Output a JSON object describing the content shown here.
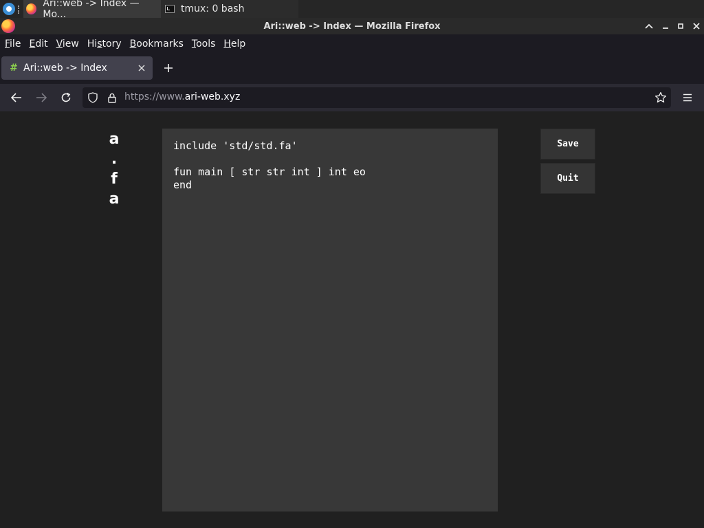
{
  "taskbar": {
    "tasks": [
      {
        "label": "Ari::web -> Index — Mo...",
        "icon": "firefox-icon"
      },
      {
        "label": "tmux: 0 bash",
        "icon": "terminal-icon"
      }
    ]
  },
  "window": {
    "title": "Ari::web -> Index — Mozilla Firefox"
  },
  "menu": {
    "items": [
      {
        "label": "File",
        "u": "F",
        "rest": "ile"
      },
      {
        "label": "Edit",
        "u": "E",
        "rest": "dit"
      },
      {
        "label": "View",
        "u": "V",
        "rest": "iew"
      },
      {
        "label": "History",
        "u": "",
        "pre": "Hi",
        "uu": "s",
        "rest": "tory"
      },
      {
        "label": "Bookmarks",
        "u": "B",
        "rest": "ookmarks"
      },
      {
        "label": "Tools",
        "u": "T",
        "rest": "ools"
      },
      {
        "label": "Help",
        "u": "H",
        "rest": "elp"
      }
    ]
  },
  "tab": {
    "title": "Ari::web -> Index",
    "favicon": "hash-icon"
  },
  "urlbar": {
    "scheme_prefix": "https://www.",
    "host": "ari-web.xyz"
  },
  "page": {
    "vertical_name": [
      "a",
      ".",
      "f",
      "a"
    ],
    "editor_text": "include 'std/std.fa'\n\nfun main [ str str int ] int eo\nend",
    "buttons": {
      "save": "Save",
      "quit": "Quit"
    }
  }
}
